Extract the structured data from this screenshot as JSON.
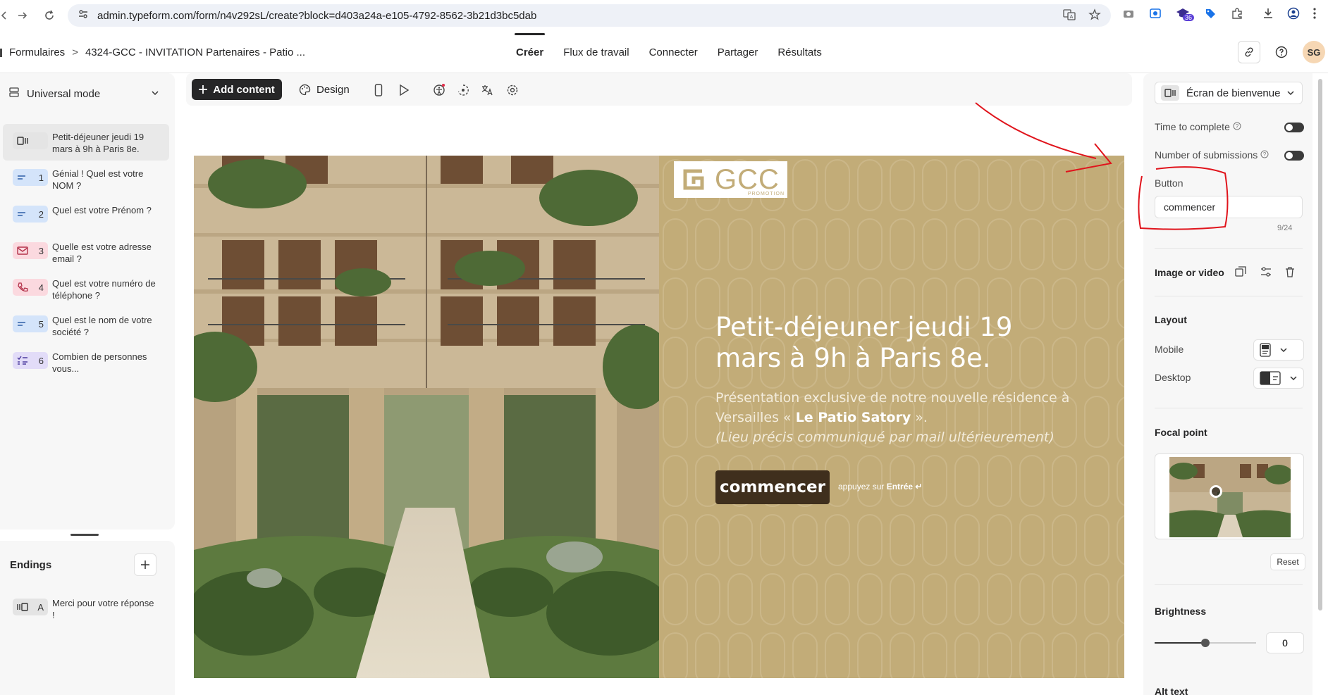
{
  "browser": {
    "url": "admin.typeform.com/form/n4v292sL/create?block=d403a24a-e105-4792-8562-3b21d3bc5dab",
    "extension_badge": "36"
  },
  "header": {
    "breadcrumb_root": "Formulaires",
    "breadcrumb_sep": ">",
    "form_title": "4324-GCC - INVITATION Partenaires - Patio ...",
    "tabs": [
      {
        "label": "Créer",
        "active": true
      },
      {
        "label": "Flux de travail",
        "active": false
      },
      {
        "label": "Connecter",
        "active": false
      },
      {
        "label": "Partager",
        "active": false
      },
      {
        "label": "Résultats",
        "active": false
      }
    ],
    "avatar_initials": "SG"
  },
  "sidebar": {
    "mode_label": "Universal mode",
    "questions": [
      {
        "num": "",
        "label": "Petit-déjeuner jeudi 19 mars à 9h à Paris 8e.",
        "color": "#e4e4e4",
        "icon": "welcome-screen-icon",
        "active": true
      },
      {
        "num": "1",
        "label": "Génial ! Quel est votre NOM ?",
        "color": "#d4e4fa",
        "icon": "short-text-icon"
      },
      {
        "num": "2",
        "label": "Quel est votre Prénom ?",
        "color": "#d4e4fa",
        "icon": "short-text-icon"
      },
      {
        "num": "3",
        "label": "Quelle est votre adresse email ?",
        "color": "#fbd9df",
        "icon": "email-icon"
      },
      {
        "num": "4",
        "label": "Quel est votre numéro de téléphone ?",
        "color": "#fbd9df",
        "icon": "phone-icon"
      },
      {
        "num": "5",
        "label": "Quel est le nom de votre société ?",
        "color": "#d4e4fa",
        "icon": "short-text-icon"
      },
      {
        "num": "6",
        "label": "Combien de personnes vous...",
        "color": "#e2dcf8",
        "icon": "multiple-choice-icon"
      }
    ],
    "endings_title": "Endings",
    "endings": [
      {
        "num": "A",
        "label": "Merci pour votre réponse !",
        "color": "#e4e4e4"
      }
    ]
  },
  "toolbar": {
    "add_content": "Add content",
    "design": "Design"
  },
  "canvas": {
    "brand_color": "#c2ac78",
    "logo_text": "GCC",
    "logo_sub": "PROMOTION",
    "title": "Petit-déjeuner jeudi 19 mars à 9h à Paris 8e.",
    "desc_line1": "Présentation exclusive de notre nouvelle résidence à Versailles «",
    "desc_bold": "Le Patio Satory",
    "desc_line1_end": "».",
    "desc_italic": "(Lieu précis communiqué par mail ultérieurement)",
    "button_label": "commencer",
    "press_hint_pre": "appuyez sur",
    "press_hint_key": "Entrée ↵"
  },
  "right_panel": {
    "screen_type": "Écran de bienvenue",
    "time_to_complete": "Time to complete",
    "number_of_submissions": "Number of submissions",
    "button_label": "Button",
    "button_value": "commencer",
    "char_count": "9/24",
    "image_or_video": "Image or video",
    "layout": "Layout",
    "mobile": "Mobile",
    "desktop": "Desktop",
    "focal_point": "Focal point",
    "reset": "Reset",
    "brightness": "Brightness",
    "brightness_value": "0",
    "brightness_level": 0.5,
    "alt_text": "Alt text"
  }
}
